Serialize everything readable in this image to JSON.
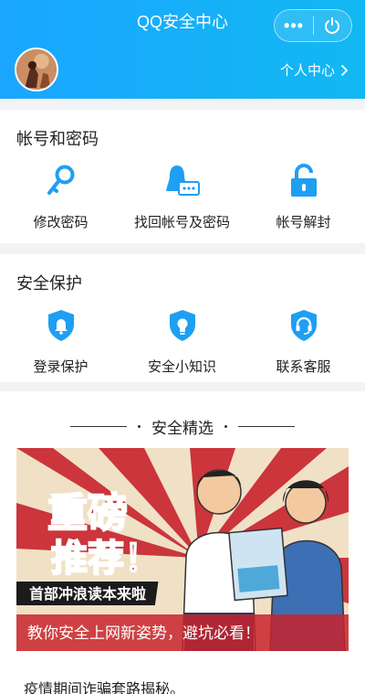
{
  "header": {
    "title": "QQ安全中心",
    "more_label": "•••",
    "personal_center": "个人中心"
  },
  "sections": [
    {
      "title": "帐号和密码",
      "items": [
        {
          "label": "修改密码",
          "icon": "key-icon"
        },
        {
          "label": "找回帐号及密码",
          "icon": "user-card-icon"
        },
        {
          "label": "帐号解封",
          "icon": "unlock-icon"
        }
      ]
    },
    {
      "title": "安全保护",
      "items": [
        {
          "label": "登录保护",
          "icon": "shield-bell-icon"
        },
        {
          "label": "安全小知识",
          "icon": "shield-bulb-icon"
        },
        {
          "label": "联系客服",
          "icon": "shield-headset-icon"
        }
      ]
    }
  ],
  "featured": {
    "title": "安全精选",
    "banner": {
      "headline_1": "重磅",
      "headline_2": "推荐！",
      "subline": "首部冲浪读本来啦",
      "caption": "教你安全上网新姿势，避坑必看！"
    },
    "article_title": "疫情期间诈骗套路揭秘。"
  },
  "colors": {
    "accent": "#1e9ff2",
    "header": "#17aff5",
    "banner_red": "#c8232c"
  }
}
